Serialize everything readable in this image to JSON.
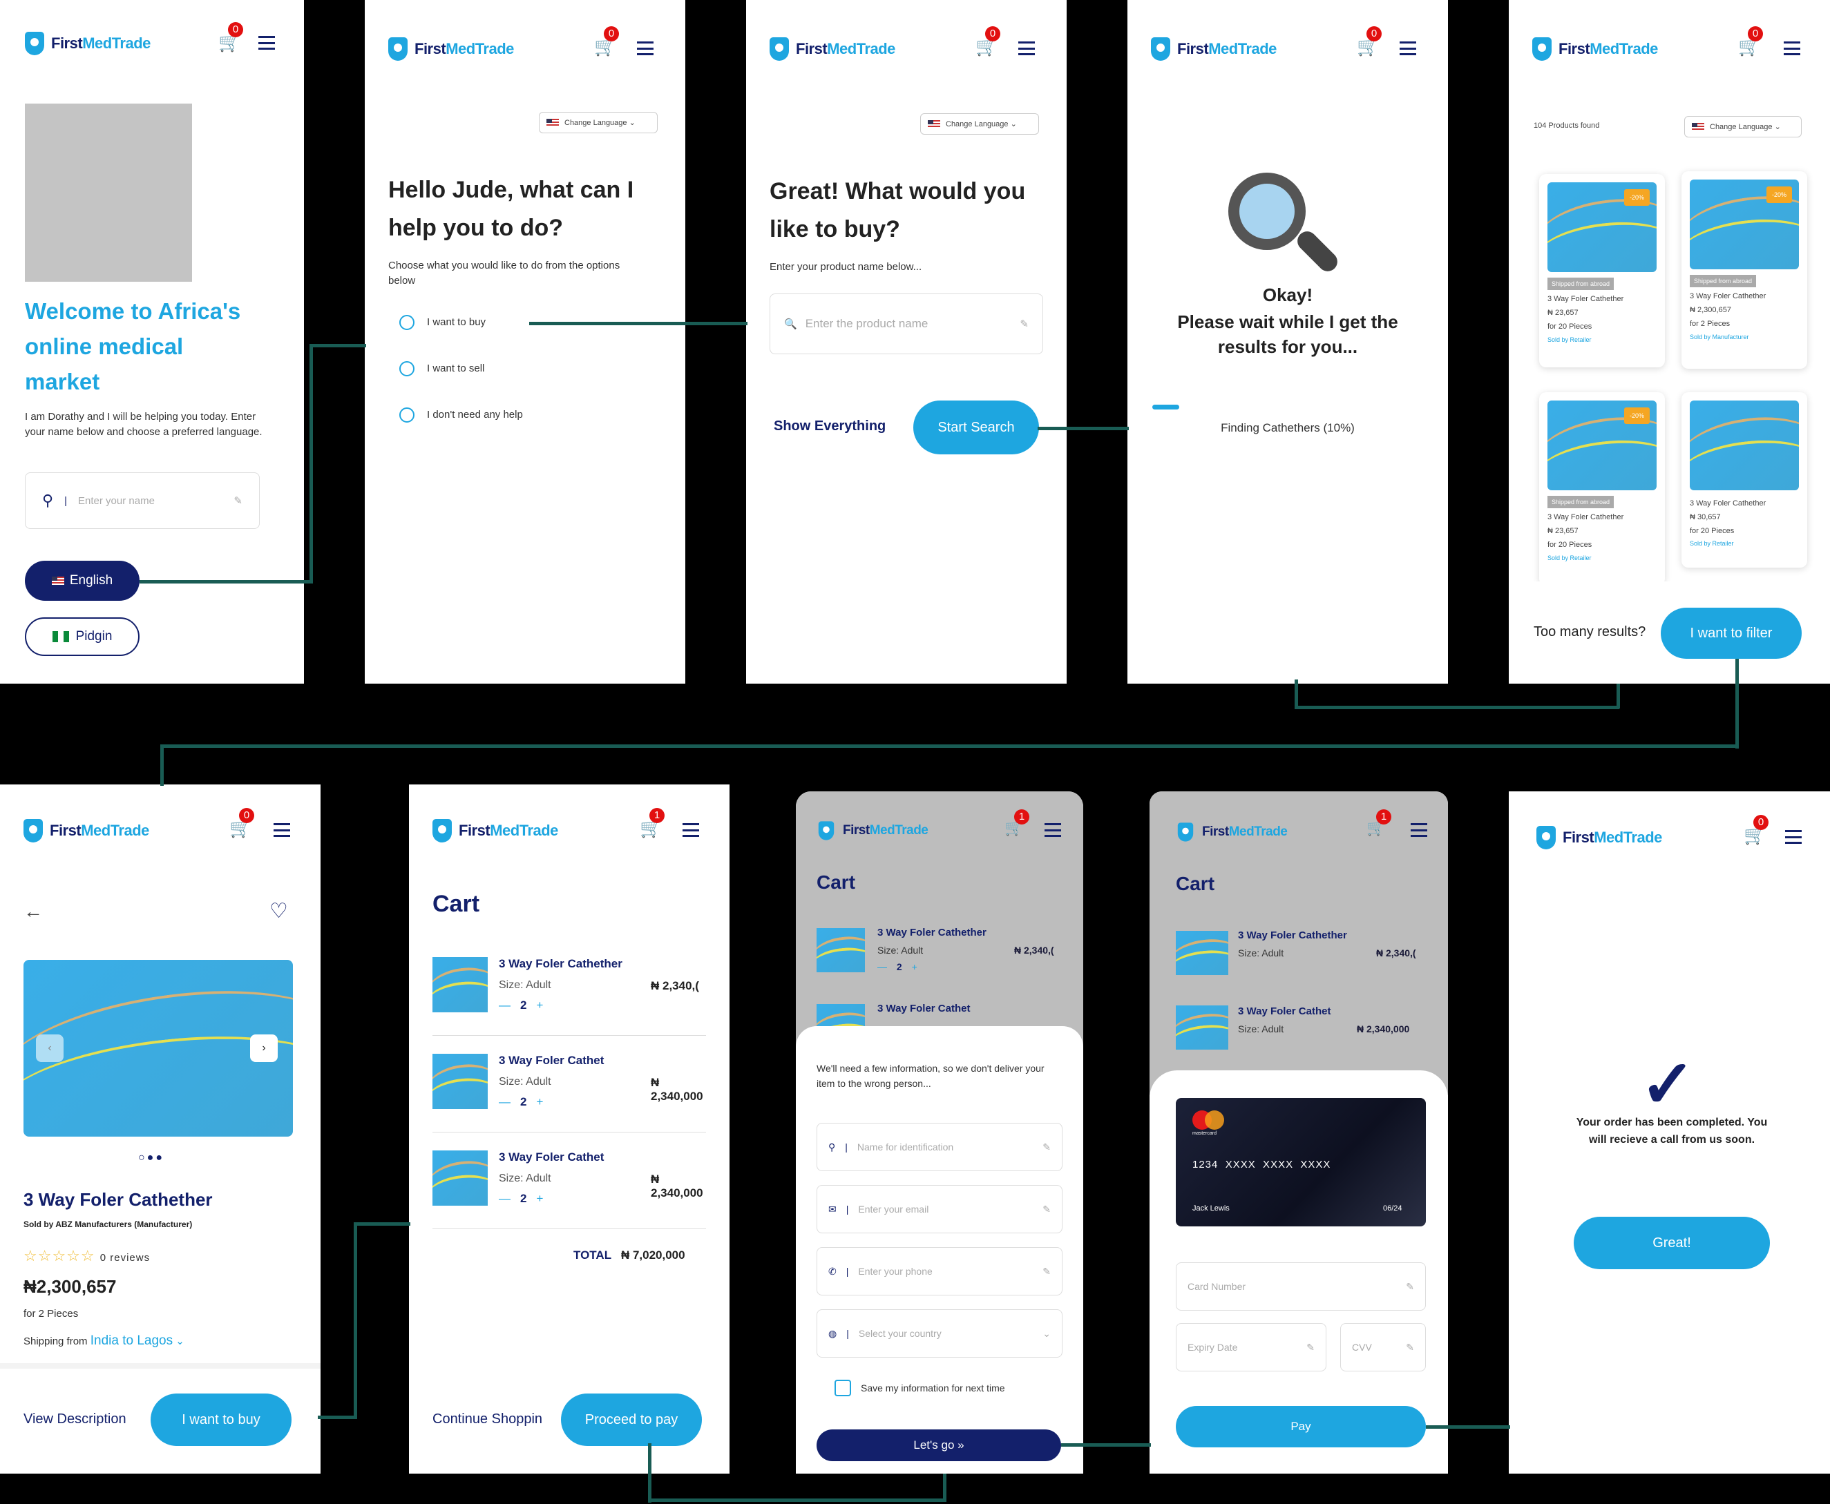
{
  "brand": {
    "first": "First",
    "med": "MedTrade"
  },
  "s1": {
    "cart_count": "0",
    "welcome": "Welcome to Africa's online medical market",
    "intro": "I am Dorathy and I will be helping you today. Enter your name below and choose a preferred language.",
    "name_placeholder": "Enter your name",
    "english": "English",
    "pidgin": "Pidgin"
  },
  "s2": {
    "cart_count": "0",
    "lang": "Change Language",
    "title": "Hello Jude, what can I help you to do?",
    "sub": "Choose what you would like to do from the options below",
    "opt1": "I want to buy",
    "opt2": "I want to sell",
    "opt3": "I don't need any help"
  },
  "s3": {
    "cart_count": "0",
    "lang": "Change Language",
    "title": "Great! What would you like to buy?",
    "sub": "Enter your product name below...",
    "search_placeholder": "Enter the product name",
    "show_all": "Show Everything",
    "start": "Start Search"
  },
  "s4": {
    "cart_count": "0",
    "title": "Okay!",
    "msg": "Please wait while I get the results for you...",
    "progress": 0.1,
    "status": "Finding Cathethers (10%)"
  },
  "s5": {
    "cart_count": "0",
    "found": "104 Products found",
    "lang": "Change Language",
    "products": [
      {
        "disc": "-20%",
        "tag": "Shipped from abroad",
        "name": "3 Way Foler Cathether",
        "price": "₦ 23,657",
        "qty": "for 20 Pieces",
        "sold": "Sold by Retailer"
      },
      {
        "disc": "-20%",
        "tag": "Shipped from abroad",
        "name": "3 Way Foler Cathether",
        "price": "₦ 2,300,657",
        "qty": "for 2 Pieces",
        "sold": "Sold by Manufacturer"
      },
      {
        "disc": "-20%",
        "tag": "Shipped from abroad",
        "name": "3 Way Foler Cathether",
        "price": "₦ 23,657",
        "qty": "for 20 Pieces",
        "sold": "Sold by Retailer"
      },
      {
        "disc": "",
        "tag": "",
        "name": "3 Way Foler Cathether",
        "price": "₦ 30,657",
        "qty": "for 20 Pieces",
        "sold": "Sold by Retailer"
      }
    ],
    "too_many": "Too many results?",
    "filter": "I want to filter"
  },
  "s6": {
    "cart_count": "0",
    "name": "3 Way Foler Cathether",
    "soldby": "Sold by ABZ Manufacturers (Manufacturer)",
    "reviews": "0 reviews",
    "price": "₦2,300,657",
    "qty": "for 2 Pieces",
    "ship_label": "Shipping from",
    "ship_route": "India to Lagos",
    "view": "View Description",
    "buy": "I want to buy",
    "rating": 0
  },
  "cart_items": [
    {
      "title": "3 Way Foler Cathether",
      "size_label": "Size:",
      "size": "Adult",
      "price": "₦ 2,340,(",
      "qty": "2"
    },
    {
      "title": "3 Way Foler Cathet",
      "size_label": "Size:",
      "size": "Adult",
      "price": "₦ 2,340,000",
      "qty": "2"
    },
    {
      "title": "3 Way Foler Cathet",
      "size_label": "Size:",
      "size": "Adult",
      "price": "₦ 2,340,000",
      "qty": "2"
    }
  ],
  "s7": {
    "cart_count": "1",
    "title": "Cart",
    "total_label": "TOTAL",
    "total": "₦ 7,020,000",
    "continue": "Continue Shoppin",
    "proceed": "Proceed to pay"
  },
  "s8": {
    "cart_count": "1",
    "title": "Cart",
    "msg": "We'll need a few information, so we don't deliver your item to the wrong person...",
    "name_ph": "Name for identification",
    "email_ph": "Enter your email",
    "phone_ph": "Enter your phone",
    "country_ph": "Select your country",
    "save": "Save my information for next time",
    "go": "Let's go »",
    "item2_title": "3 Way Foler Cathet"
  },
  "s9": {
    "cart_count": "1",
    "title": "Cart",
    "card_brand": "mastercard",
    "card_no": "1234  XXXX  XXXX  XXXX",
    "holder": "Jack Lewis",
    "expiry": "06/24",
    "card_ph": "Card Number",
    "exp_ph": "Expiry Date",
    "cvv_ph": "CVV",
    "pay": "Pay"
  },
  "s10": {
    "cart_count": "0",
    "msg": "Your order has been completed. You will recieve a call from us soon.",
    "great": "Great!"
  },
  "colors": {
    "brand_blue": "#1ea6e0",
    "navy": "#13206b",
    "connector": "#195c54",
    "badge": "#e21010"
  }
}
